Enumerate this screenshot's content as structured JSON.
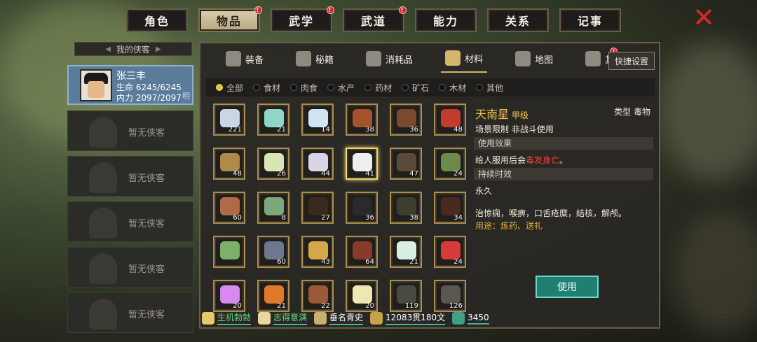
{
  "top_tabs": [
    {
      "label": "角色",
      "active": false,
      "badge": false
    },
    {
      "label": "物品",
      "active": true,
      "badge": true
    },
    {
      "label": "武学",
      "active": false,
      "badge": true
    },
    {
      "label": "武道",
      "active": false,
      "badge": true
    },
    {
      "label": "能力",
      "active": false,
      "badge": false
    },
    {
      "label": "关系",
      "active": false,
      "badge": false
    },
    {
      "label": "记事",
      "active": false,
      "badge": false
    }
  ],
  "badge_symbol": "!",
  "close_icon": "close-x-icon",
  "sidebar": {
    "title": "我的侠客",
    "hero": {
      "name": "张三丰",
      "hp": "生命 6245/6245",
      "mp": "内力 2097/2097",
      "tag": "明"
    },
    "empty_label": "暂无侠客"
  },
  "subtabs": [
    {
      "label": "装备",
      "icon": "armor-icon",
      "active": false
    },
    {
      "label": "秘籍",
      "icon": "book-icon",
      "active": false
    },
    {
      "label": "消耗品",
      "icon": "potion-icon",
      "active": false
    },
    {
      "label": "材料",
      "icon": "herb-icon",
      "active": true
    },
    {
      "label": "地图",
      "icon": "map-icon",
      "active": false
    },
    {
      "label": "其他",
      "icon": "misc-icon",
      "active": false,
      "badge": true
    }
  ],
  "quick_settings": "快捷设置",
  "filters": [
    {
      "label": "全部",
      "on": true
    },
    {
      "label": "食材",
      "on": false
    },
    {
      "label": "肉食",
      "on": false
    },
    {
      "label": "水产",
      "on": false
    },
    {
      "label": "药材",
      "on": false
    },
    {
      "label": "矿石",
      "on": false
    },
    {
      "label": "木材",
      "on": false
    },
    {
      "label": "其他",
      "on": false
    }
  ],
  "items": [
    {
      "count": "221",
      "color": "#c9d6e6",
      "icon": "fish-icon"
    },
    {
      "count": "21",
      "color": "#8fd6c9",
      "icon": "bowl-icon"
    },
    {
      "count": "14",
      "color": "#cfe4f4",
      "icon": "ice-cube-icon"
    },
    {
      "count": "38",
      "color": "#a5522c",
      "icon": "mushroom-icon"
    },
    {
      "count": "36",
      "color": "#7a4a2e",
      "icon": "meat-icon"
    },
    {
      "count": "48",
      "color": "#c23b2b",
      "icon": "raw-meat-icon"
    },
    {
      "count": "48",
      "color": "#b08a4a",
      "icon": "firewood-icon"
    },
    {
      "count": "26",
      "color": "#d8e6b6",
      "icon": "flower-bulb-icon"
    },
    {
      "count": "44",
      "color": "#d9d4e8",
      "icon": "herb-flower-icon"
    },
    {
      "count": "41",
      "color": "#eeeeee",
      "icon": "white-stones-icon",
      "selected": true
    },
    {
      "count": "47",
      "color": "#5a4a3a",
      "icon": "branches-icon"
    },
    {
      "count": "24",
      "color": "#6c8a4a",
      "icon": "vine-icon"
    },
    {
      "count": "60",
      "color": "#b06a4a",
      "icon": "nuts-icon"
    },
    {
      "count": "8",
      "color": "#7da87a",
      "icon": "root-icon"
    },
    {
      "count": "27",
      "color": "#3a2a1e",
      "icon": "centipede-icon"
    },
    {
      "count": "36",
      "color": "#2a2a2a",
      "icon": "beetle-icon"
    },
    {
      "count": "38",
      "color": "#3e3e30",
      "icon": "bug-icon"
    },
    {
      "count": "34",
      "color": "#4a2a1e",
      "icon": "ant-icon"
    },
    {
      "count": "",
      "color": "#7fb06a",
      "icon": "leaf-icon"
    },
    {
      "count": "60",
      "color": "#6c7890",
      "icon": "iron-ore-icon"
    },
    {
      "count": "43",
      "color": "#d4a84a",
      "icon": "gold-ore-icon"
    },
    {
      "count": "64",
      "color": "#8a3a2a",
      "icon": "coal-icon"
    },
    {
      "count": "21",
      "color": "#d8f0e4",
      "icon": "jade-icon"
    },
    {
      "count": "24",
      "color": "#d83a3a",
      "icon": "red-pearl-icon"
    },
    {
      "count": "20",
      "color": "#d68af0",
      "icon": "crystal-icon"
    },
    {
      "count": "21",
      "color": "#e07a2a",
      "icon": "amber-icon"
    },
    {
      "count": "22",
      "color": "#9a5a3a",
      "icon": "log-icon"
    },
    {
      "count": "20",
      "color": "#f0e6b0",
      "icon": "pearl-icon"
    },
    {
      "count": "119",
      "color": "#4a4a40",
      "icon": "black-wood-icon"
    },
    {
      "count": "126",
      "color": "#5a5650",
      "icon": "stone-slab-icon"
    }
  ],
  "detail": {
    "name": "天南星",
    "grade": "甲级",
    "type": "类型  毒物",
    "scene": "场景限制   非战斗使用",
    "effect_header": "使用效果",
    "effect_prefix": "给人服用后会",
    "effect_red": "毒发身亡",
    "effect_suffix": "。",
    "duration_header": "持续时效",
    "duration": "永久",
    "desc": "治惊痫，喉痹，口舌疮糜，结核，解颅。",
    "usage": "用途：炼药、送礼",
    "use_button": "使用"
  },
  "status": [
    {
      "label": "生机勃勃",
      "icon": "strength-icon",
      "color": "#5fd87a"
    },
    {
      "label": "志得意满",
      "icon": "smile-icon",
      "color": "#5fd87a"
    },
    {
      "label": "垂名青史",
      "icon": "scroll-icon",
      "color": "#ffffff"
    },
    {
      "label": "12083贯180文",
      "icon": "coin-icon",
      "color": "#ffffff"
    },
    {
      "label": "3450",
      "icon": "jade-coin-icon",
      "color": "#ffffff"
    }
  ]
}
